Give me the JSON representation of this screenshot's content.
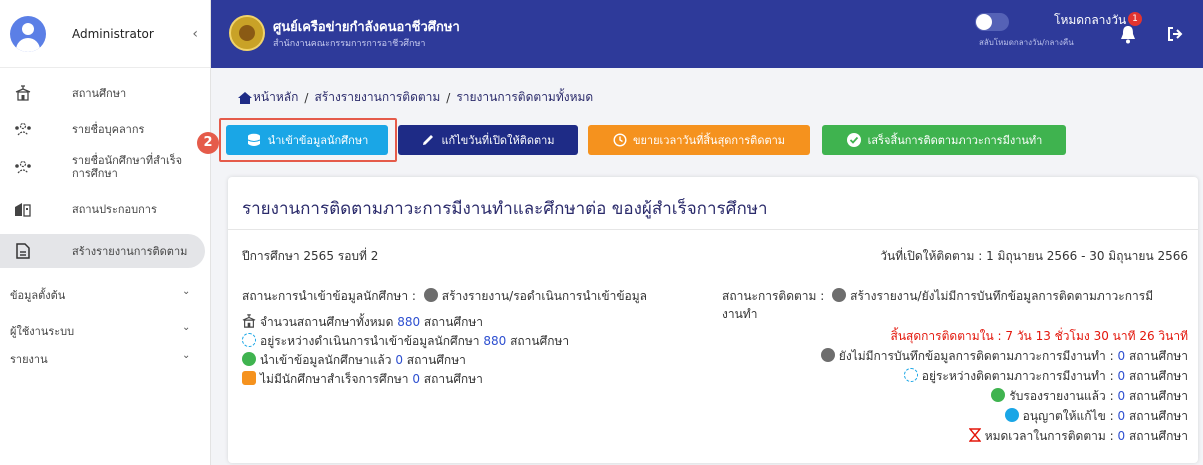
{
  "sidebar": {
    "user_name": "Administrator",
    "items": [
      {
        "label": "สถานศึกษา"
      },
      {
        "label": "รายชื่อบุคลากร"
      },
      {
        "label": "รายชื่อนักศึกษาที่สำเร็จการศึกษา"
      },
      {
        "label": "สถานประกอบการ"
      },
      {
        "label": "สร้างรายงานการติดตาม"
      }
    ],
    "groups": [
      {
        "label": "ข้อมูลตั้งต้น"
      },
      {
        "label": "ผู้ใช้งานระบบ"
      },
      {
        "label": "รายงาน"
      }
    ]
  },
  "header": {
    "title": "ศูนย์เครือข่ายกำลังคนอาชีวศึกษา",
    "subtitle": "สำนักงานคณะกรรมการการอาชีวศึกษา",
    "mode_label": "โหมดกลางวัน",
    "mode_sub": "สลับโหมดกลางวัน/กลางคืน",
    "notification_count": "1"
  },
  "breadcrumb": {
    "home": "หน้าหลัก",
    "sep": "/",
    "level2": "สร้างรายงานการติดตาม",
    "level3": "รายงานการติดตามทั้งหมด"
  },
  "step_badge": "2",
  "buttons": {
    "import": "นำเข้าข้อมูลนักศึกษา",
    "edit_date": "แก้ไขวันที่เปิดให้ติดตาม",
    "extend": "ขยายเวลาวันที่สิ้นสุดการติดตาม",
    "finish": "เสร็จสิ้นการติดตามภาวะการมีงานทำ"
  },
  "card": {
    "title": "รายงานการติดตามภาวะการมีงานทำและศึกษาต่อ ของผู้สำเร็จการศึกษา",
    "year": "ปีการศึกษา 2565 รอบที่ 2",
    "open_dates": "วันที่เปิดให้ติดตาม : 1 มิถุนายน 2566 - 30 มิถุนายน 2566",
    "import_status_label": "สถานะการนำเข้าข้อมูลนักศึกษา :",
    "import_status_value": "สร้างรายงาน/รอดำเนินการนำเข้าข้อมูล",
    "left_stats": [
      {
        "label": "จำนวนสถานศึกษาทั้งหมด",
        "value": "880",
        "unit": "สถานศึกษา"
      },
      {
        "label": "อยู่ระหว่างดำเนินการนำเข้าข้อมูลนักศึกษา",
        "value": "880",
        "unit": "สถานศึกษา"
      },
      {
        "label": "นำเข้าข้อมูลนักศึกษาแล้ว",
        "value": "0",
        "unit": "สถานศึกษา"
      },
      {
        "label": "ไม่มีนักศึกษาสำเร็จการศึกษา",
        "value": "0",
        "unit": "สถานศึกษา"
      }
    ],
    "track_status_label": "สถานะการติดตาม :",
    "track_status_value_1": "สร้างรายงาน/ยังไม่มีการบันทึกข้อมูลการติดตามภาวะการมี",
    "track_status_value_2": "งานทำ",
    "countdown": "สิ้นสุดการติดตามใน : 7 วัน 13 ชั่วโมง 30 นาที 26 วินาที",
    "right_stats": [
      {
        "label": "ยังไม่มีการบันทึกข้อมูลการติดตามภาวะการมีงานทำ :",
        "value": "0",
        "unit": "สถานศึกษา"
      },
      {
        "label": "อยู่ระหว่างติดตามภาวะการมีงานทำ :",
        "value": "0",
        "unit": "สถานศึกษา"
      },
      {
        "label": "รับรองรายงานแล้ว :",
        "value": "0",
        "unit": "สถานศึกษา"
      },
      {
        "label": "อนุญาตให้แก้ไข :",
        "value": "0",
        "unit": "สถานศึกษา"
      },
      {
        "label": "หมดเวลาในการติดตาม :",
        "value": "0",
        "unit": "สถานศึกษา"
      }
    ]
  },
  "colors": {
    "topbar": "#2e3a9a",
    "import_button": "#1aa6e6",
    "edit_button": "#1e2b86",
    "extend_button": "#f5921e",
    "finish_button": "#3fb34f",
    "highlight": "#e55b4a",
    "countdown": "#e3160b"
  }
}
